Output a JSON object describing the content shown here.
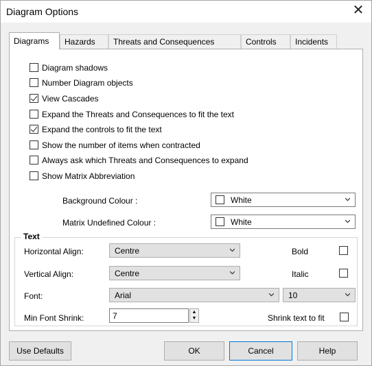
{
  "window": {
    "title": "Diagram Options",
    "close_glyph": "✕"
  },
  "tabs": [
    {
      "label": "Diagrams",
      "active": true
    },
    {
      "label": "Hazards",
      "active": false
    },
    {
      "label": "Threats and Consequences",
      "active": false
    },
    {
      "label": "Controls",
      "active": false
    },
    {
      "label": "Incidents",
      "active": false
    }
  ],
  "options": [
    {
      "label": "Diagram shadows",
      "checked": false
    },
    {
      "label": "Number Diagram objects",
      "checked": false
    },
    {
      "label": "View Cascades",
      "checked": true
    },
    {
      "label": "Expand the Threats and Consequences to fit the text",
      "checked": false
    },
    {
      "label": "Expand the controls to fit the text",
      "checked": true
    },
    {
      "label": "Show the number of items when contracted",
      "checked": false
    },
    {
      "label": "Always ask which Threats and Consequences to expand",
      "checked": false
    },
    {
      "label": "Show Matrix Abbreviation",
      "checked": false
    }
  ],
  "colours": {
    "background": {
      "label": "Background Colour :",
      "value": "White",
      "swatch": "#ffffff"
    },
    "undefined": {
      "label": "Matrix Undefined Colour :",
      "value": "White",
      "swatch": "#ffffff"
    }
  },
  "text_group": {
    "title": "Text",
    "horizontal_align": {
      "label": "Horizontal Align:",
      "value": "Centre"
    },
    "vertical_align": {
      "label": "Vertical Align:",
      "value": "Centre"
    },
    "font": {
      "label": "Font:",
      "value": "Arial",
      "size": "10"
    },
    "min_font_shrink": {
      "label": "Min Font Shrink:",
      "value": "7"
    },
    "bold": {
      "label": "Bold",
      "checked": false
    },
    "italic": {
      "label": "Italic",
      "checked": false
    },
    "shrink_to_fit": {
      "label": "Shrink text to fit",
      "checked": false
    }
  },
  "buttons": {
    "use_defaults": "Use Defaults",
    "ok": "OK",
    "cancel": "Cancel",
    "help": "Help"
  }
}
